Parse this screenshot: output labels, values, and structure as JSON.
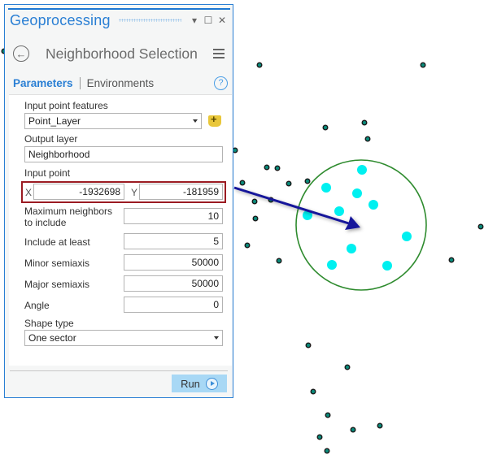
{
  "panel": {
    "title": "Geoprocessing",
    "window_buttons": {
      "dropdown": "▾",
      "maximize": "☐",
      "close": "✕"
    },
    "tool_title": "Neighborhood Selection",
    "tabs": [
      {
        "label": "Parameters",
        "active": true
      },
      {
        "label": "Environments",
        "active": false
      }
    ],
    "help_label": "?",
    "back_icon": "←"
  },
  "params": {
    "input_features": {
      "label": "Input point features",
      "value": "Point_Layer"
    },
    "output_layer": {
      "label": "Output layer",
      "value": "Neighborhood"
    },
    "input_point": {
      "label": "Input point",
      "x_label": "X",
      "x_value": "-1932698",
      "y_label": "Y",
      "y_value": "-181959"
    },
    "max_neighbors": {
      "label_line1": "Maximum neighbors",
      "label_line2": "to include",
      "value": "10"
    },
    "include_at_least": {
      "label": "Include at least",
      "value": "5"
    },
    "minor_semiaxis": {
      "label": "Minor semiaxis",
      "value": "50000"
    },
    "major_semiaxis": {
      "label": "Major semiaxis",
      "value": "50000"
    },
    "angle": {
      "label": "Angle",
      "value": "0"
    },
    "shape_type": {
      "label": "Shape type",
      "value": "One sector"
    }
  },
  "footer": {
    "run_label": "Run"
  },
  "map": {
    "colors": {
      "point_fill": "#0a8a7a",
      "point_outline": "#1a1a1a",
      "selected": "#00f0f0",
      "circle": "#2e8b2e",
      "arrow": "#14149a"
    },
    "unselected_points": [
      [
        319,
        80
      ],
      [
        520,
        80
      ],
      [
        400,
        157
      ],
      [
        448,
        151
      ],
      [
        452,
        171
      ],
      [
        289,
        185
      ],
      [
        328,
        206
      ],
      [
        341,
        207
      ],
      [
        298,
        225
      ],
      [
        355,
        226
      ],
      [
        378,
        223
      ],
      [
        313,
        248
      ],
      [
        333,
        246
      ],
      [
        314,
        269
      ],
      [
        304,
        302
      ],
      [
        343,
        321
      ],
      [
        555,
        320
      ],
      [
        591,
        279
      ],
      [
        5,
        63
      ],
      [
        379,
        425
      ],
      [
        427,
        452
      ],
      [
        385,
        482
      ],
      [
        403,
        511
      ],
      [
        434,
        529
      ],
      [
        467,
        524
      ],
      [
        393,
        538
      ],
      [
        402,
        555
      ]
    ],
    "selected_points": [
      [
        445,
        209
      ],
      [
        401,
        231
      ],
      [
        439,
        238
      ],
      [
        459,
        252
      ],
      [
        417,
        260
      ],
      [
        378,
        265
      ],
      [
        500,
        291
      ],
      [
        432,
        306
      ],
      [
        408,
        326
      ],
      [
        476,
        327
      ]
    ]
  }
}
